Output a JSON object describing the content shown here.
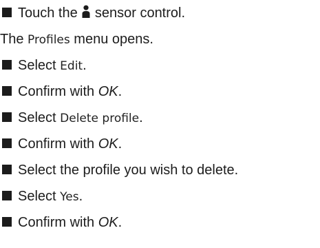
{
  "steps": [
    {
      "bullet": true,
      "parts": [
        "Touch the ",
        "icon:person",
        " sensor control."
      ]
    },
    {
      "bullet": false,
      "parts": [
        "The ",
        "Profiles",
        " menu opens."
      ]
    },
    {
      "bullet": true,
      "parts": [
        "Select ",
        "Edit",
        "."
      ]
    },
    {
      "bullet": true,
      "parts": [
        "Confirm with ",
        "OK",
        "."
      ]
    },
    {
      "bullet": true,
      "parts": [
        "Select ",
        "Delete profile",
        "."
      ]
    },
    {
      "bullet": true,
      "parts": [
        "Confirm with ",
        "OK",
        "."
      ]
    },
    {
      "bullet": true,
      "parts": [
        "Select the profile you wish to delete."
      ]
    },
    {
      "bullet": true,
      "parts": [
        "Select ",
        "Yes",
        "."
      ]
    },
    {
      "bullet": true,
      "parts": [
        "Confirm with ",
        "OK",
        "."
      ]
    }
  ],
  "icons": {
    "sensor_control": "person-icon"
  },
  "colors": {
    "text": "#1c1c1c",
    "bullet": "#1c1c1c",
    "background": "#ffffff"
  }
}
